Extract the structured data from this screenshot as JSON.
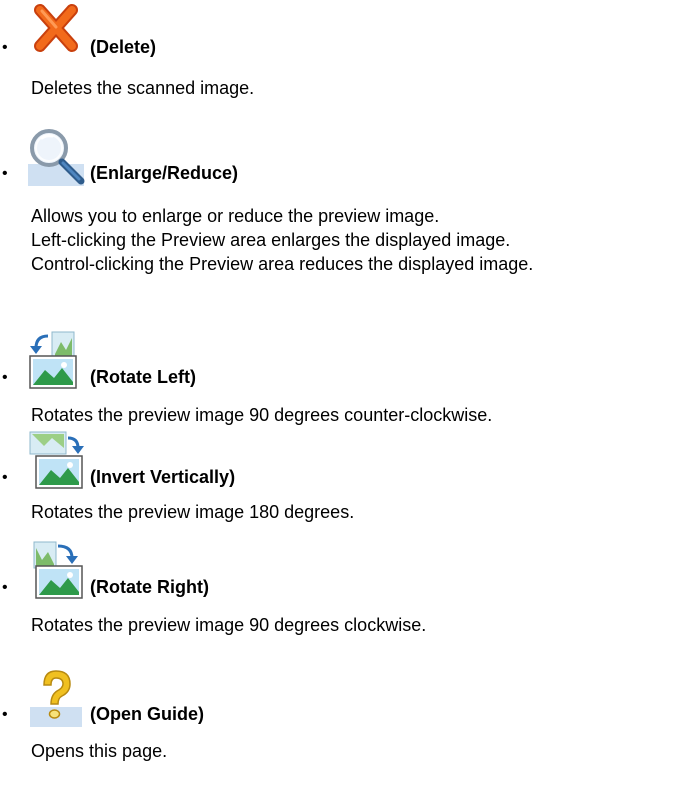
{
  "items": [
    {
      "icon": "delete-x-icon",
      "label": "(Delete)",
      "lines": [
        "Deletes the scanned image."
      ]
    },
    {
      "icon": "magnifier-icon",
      "label": "(Enlarge/Reduce)",
      "lines": [
        "Allows you to enlarge or reduce the preview image.",
        "Left-clicking the Preview area enlarges the displayed image.",
        "Control-clicking the Preview area reduces the displayed image."
      ]
    },
    {
      "icon": "rotate-left-icon",
      "label": "(Rotate Left)",
      "lines": [
        "Rotates the preview image 90 degrees counter-clockwise."
      ]
    },
    {
      "icon": "invert-vertically-icon",
      "label": "(Invert Vertically)",
      "lines": [
        "Rotates the preview image 180 degrees."
      ]
    },
    {
      "icon": "rotate-right-icon",
      "label": "(Rotate Right)",
      "lines": [
        "Rotates the preview image 90 degrees clockwise."
      ]
    },
    {
      "icon": "question-mark-icon",
      "label": "(Open Guide)",
      "lines": [
        "Opens this page."
      ]
    }
  ]
}
